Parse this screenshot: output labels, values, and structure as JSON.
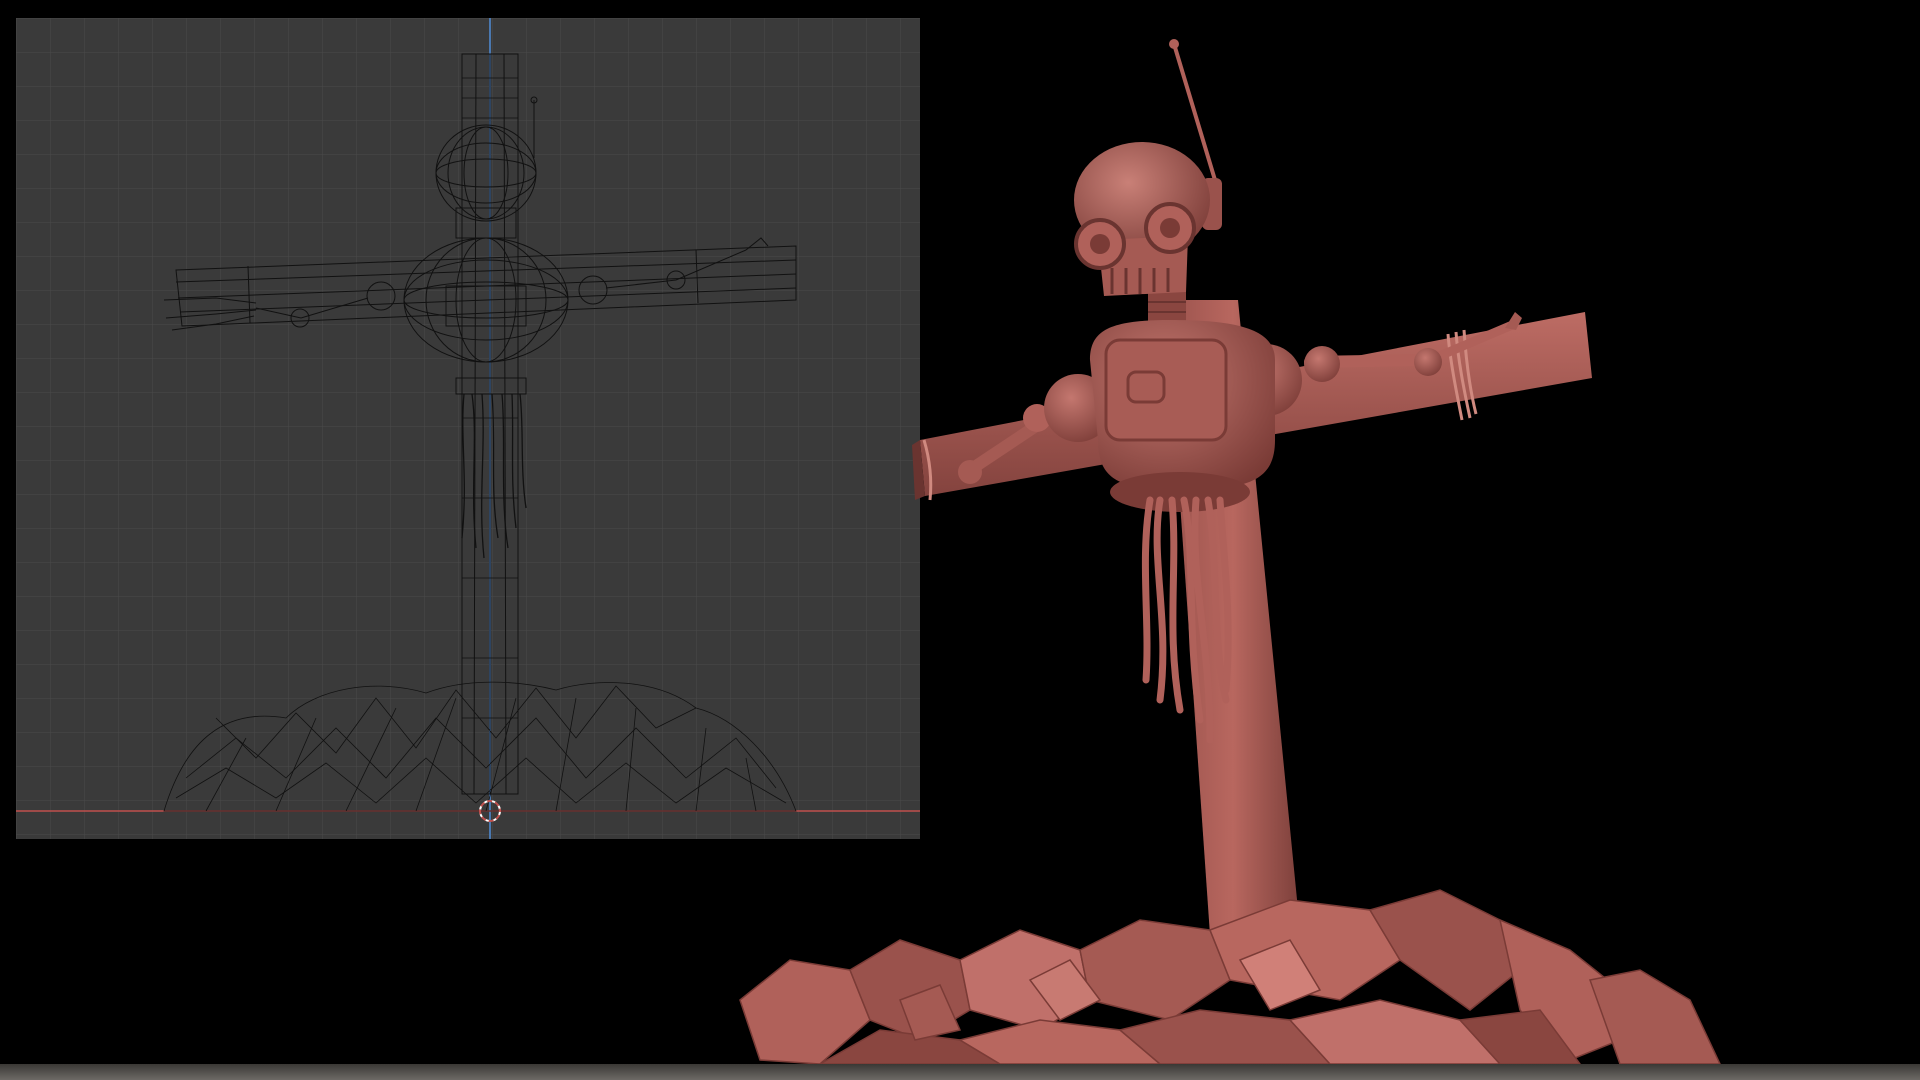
{
  "scene": {
    "description_free": true,
    "colors": {
      "background": "#000000",
      "viewport_bg": "#3a3a3a",
      "grid_line": "#4a4a4a",
      "grid_major": "#505050",
      "wire": "#111111",
      "axis_red": "#c0504d",
      "axis_blue": "#4a78b0",
      "clay": "#b0615a",
      "clay_dark": "#6a3430",
      "clay_light": "#c87a72"
    },
    "icons": {
      "origin_marker": "3d-cursor-icon"
    }
  }
}
